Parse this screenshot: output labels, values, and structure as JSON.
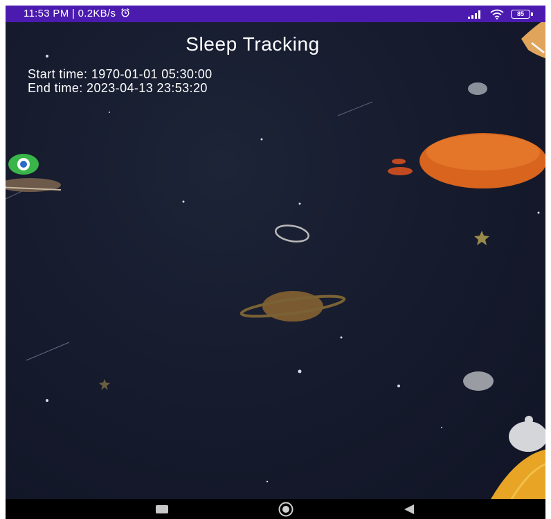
{
  "status_bar": {
    "time_speed": "11:53 PM | 0.2KB/s",
    "battery_level": "85",
    "background_color": "#4b1bb0",
    "icons": [
      "alarm-icon",
      "signal-icon",
      "wifi-icon",
      "battery-icon"
    ]
  },
  "app": {
    "title": "Sleep Tracking",
    "start_time": "Start time: 1970-01-01 05:30:00",
    "end_time": "End time: 2023-04-13 23:53:20",
    "background_color": "#151a2c"
  },
  "nav_bar": {
    "icons": [
      "recents-square-icon",
      "home-circle-icon",
      "back-triangle-icon"
    ]
  }
}
